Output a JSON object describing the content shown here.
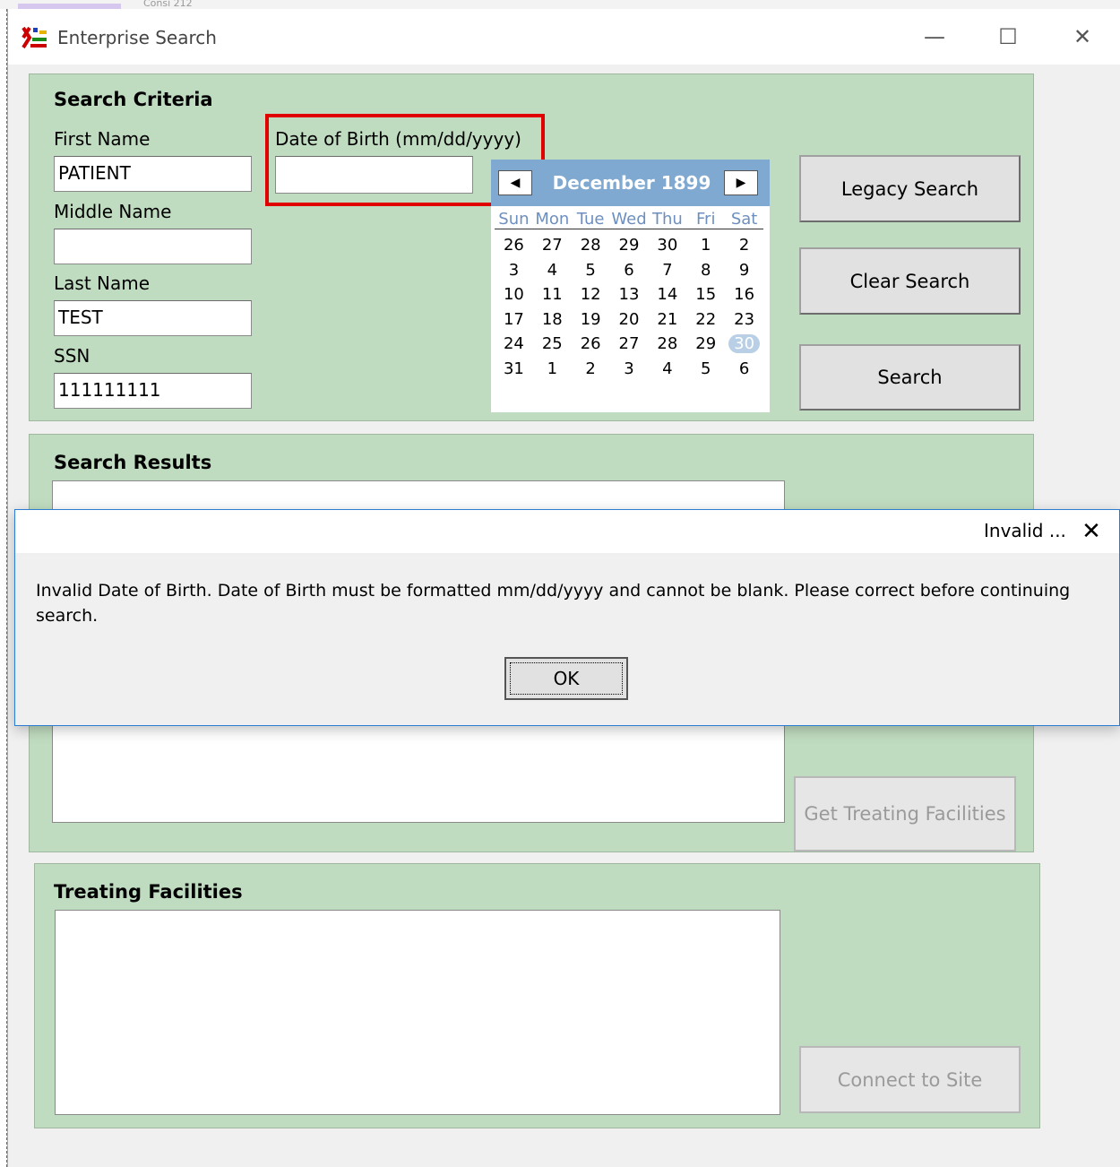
{
  "background": {
    "tab_text": "Consi 212"
  },
  "window": {
    "title": "Enterprise Search",
    "minimize_glyph": "—",
    "maximize_glyph": "☐",
    "close_glyph": "✕"
  },
  "criteria": {
    "title": "Search Criteria",
    "first_name_label": "First Name",
    "first_name_value": "PATIENT",
    "middle_name_label": "Middle Name",
    "middle_name_value": "",
    "last_name_label": "Last Name",
    "last_name_value": "TEST",
    "ssn_label": "SSN",
    "ssn_value": "111111111",
    "dob_label": "Date of Birth (mm/dd/yyyy)",
    "dob_value": "",
    "legacy_search_label": "Legacy Search",
    "clear_search_label": "Clear Search",
    "search_label": "Search"
  },
  "calendar": {
    "month_label": "December 1899",
    "prev_glyph": "◀",
    "next_glyph": "▶",
    "days_of_week": [
      "Sun",
      "Mon",
      "Tue",
      "Wed",
      "Thu",
      "Fri",
      "Sat"
    ],
    "weeks": [
      [
        "26",
        "27",
        "28",
        "29",
        "30",
        "1",
        "2"
      ],
      [
        "3",
        "4",
        "5",
        "6",
        "7",
        "8",
        "9"
      ],
      [
        "10",
        "11",
        "12",
        "13",
        "14",
        "15",
        "16"
      ],
      [
        "17",
        "18",
        "19",
        "20",
        "21",
        "22",
        "23"
      ],
      [
        "24",
        "25",
        "26",
        "27",
        "28",
        "29",
        "30"
      ],
      [
        "31",
        "1",
        "2",
        "3",
        "4",
        "5",
        "6"
      ]
    ],
    "selected_day": "30"
  },
  "results": {
    "title": "Search Results",
    "get_treating_facilities_label": "Get Treating Facilities"
  },
  "facilities": {
    "title": "Treating Facilities",
    "connect_label": "Connect to Site"
  },
  "dialog": {
    "title": "Invalid ...",
    "message": "Invalid Date of Birth.  Date of Birth must be formatted mm/dd/yyyy and cannot be blank.  Please correct before continuing search.",
    "ok_label": "OK",
    "close_glyph": "✕"
  },
  "colors": {
    "panel_green": "#c0dcc0",
    "calendar_header": "#7fa9d0",
    "highlight_red": "#e00000",
    "dialog_border": "#2d7dd2"
  }
}
